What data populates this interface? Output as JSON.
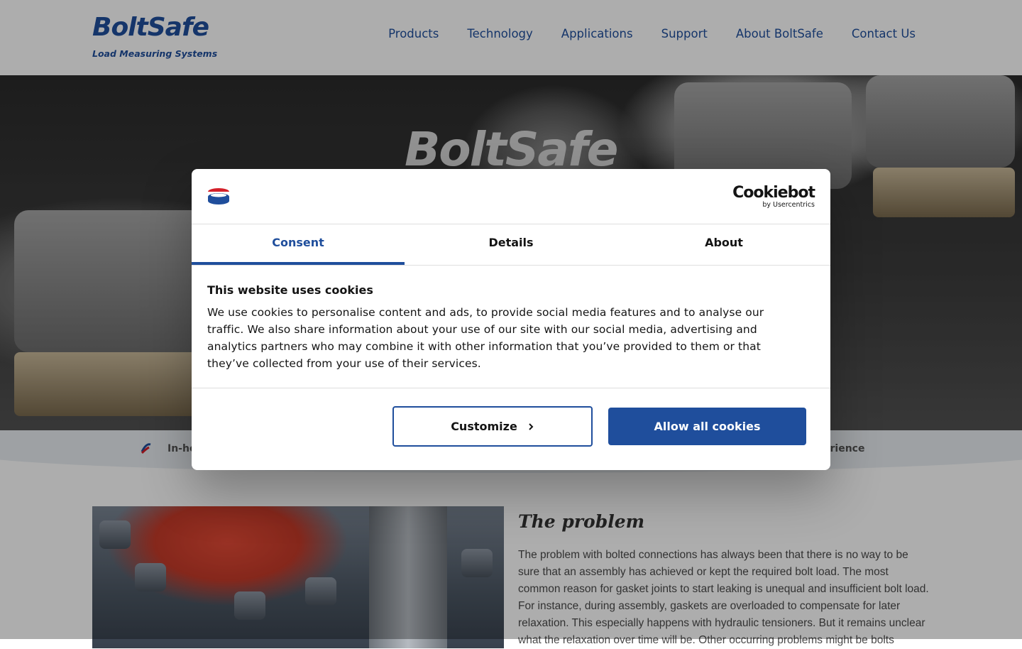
{
  "site": {
    "logo_main": "BoltSafe",
    "logo_tagline": "Load Measuring Systems",
    "nav": [
      {
        "label": "Products"
      },
      {
        "label": "Technology"
      },
      {
        "label": "Applications"
      },
      {
        "label": "Support"
      },
      {
        "label": "About BoltSafe"
      },
      {
        "label": "Contact Us"
      }
    ],
    "hero_logo": "BoltSafe"
  },
  "strip": {
    "left_text": "In-ho",
    "right_text": "perience"
  },
  "content": {
    "title": "The problem",
    "paragraph": "The problem with bolted connections has always been that there is no way to be sure that an assembly has achieved or kept the required bolt load. The most common reason for gasket joints to start leaking is unequal and insufficient bolt load. For instance, during assembly, gaskets are overloaded to compensate for later relaxation. This especially happens with hydraulic tensioners. But it remains unclear what the relaxation over time will be. Other occurring problems might be bolts"
  },
  "cookie_dialog": {
    "provider_name": "Cookiebot",
    "provider_sub": "by Usercentrics",
    "tabs": [
      {
        "label": "Consent",
        "active": true
      },
      {
        "label": "Details",
        "active": false
      },
      {
        "label": "About",
        "active": false
      }
    ],
    "title": "This website uses cookies",
    "body": "We use cookies to personalise content and ads, to provide social media features and to analyse our traffic. We also share information about your use of our site with our social media, advertising and analytics partners who may combine it with other information that you’ve provided to them or that they’ve collected from your use of their services.",
    "customize_label": "Customize",
    "allow_label": "Allow all cookies"
  },
  "colors": {
    "brand_blue": "#1f4e9c",
    "brand_red": "#d4202a",
    "overlay": "rgba(0,0,0,0.32)"
  }
}
